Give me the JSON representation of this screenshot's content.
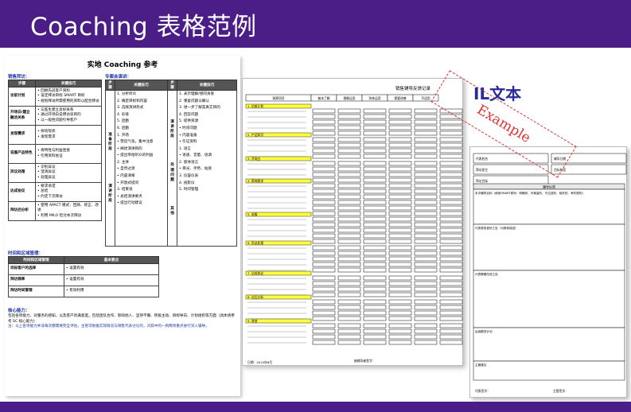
{
  "header": {
    "title": "Coaching 表格范例"
  },
  "doc1": {
    "title": "实地 Coaching 参考",
    "section_sales": "销售拜访：",
    "section_pres": "专案会演讲：",
    "table1_headers": [
      "步骤",
      "关键技巧"
    ],
    "table1_rows": [
      [
        "访前计划",
        "• 回顾先前客户资料\n• 设定拜访目标 SMART 目标\n• 规划拜访所需使用的资料以配合拜访"
      ],
      [
        "开场白/建立融洽关系",
        "• 与医生建立良好关系\n• 通过开场白说明访谈目的\n• 以一般性问题引导客户"
      ],
      [
        "发现需求",
        "• 探询现状\n• 发现需求"
      ],
      [
        "说服产品特色",
        "• 将特性与利益连接\n• 引用资料佐证"
      ],
      [
        "异议处理",
        "• 识别异议\n• 澄清异议\n• 处理异议"
      ],
      [
        "达成协议",
        "• 要求承诺\n• 总结\n• 约定下次拜访"
      ],
      [
        "拜访后分析",
        "• 使用 APACT 模式：回顾、修正、改进\n• 利用 MILO 检讨本次拜访"
      ]
    ],
    "table2_headers": [
      "步骤",
      "关键技巧",
      "步骤",
      "关键技巧"
    ],
    "table2_left_steps": [
      "准备阶段",
      "演讲阶段"
    ],
    "table2_left_items": [
      "1. 分析听众",
      "2. 确定目标和内容",
      "3. 选择演讲形式",
      "4. 彩排",
      "5. 后勤",
      "6. 后勤",
      "1. 开场",
      "• 营造气氛，集中注意",
      "• 阐述演讲目的",
      "• 提出带给听众的利益",
      "2. 主体",
      "• 自然过渡",
      "• 内容清晰",
      "• 开放式提问",
      "3. 结束语",
      "• 总结演讲要点",
      "• 提出行动建议"
    ],
    "table2_right_steps": [
      "演讲阶段",
      "处理问题",
      "其他"
    ],
    "table2_right_items": [
      "1. 表示理解/感同身受",
      "2. 重复问题以确认",
      "3. 进一步了解其真实目的",
      "4. 回答问题",
      "5. 提供资源",
      "• 时间问题",
      "• 内容准备",
      "• 引证资料",
      "1. 语言",
      "• 语速、音量、语调",
      "2. 肢体语言",
      "• 目光、手势、站姿",
      "3. 仪容仪表",
      "4. 投影仪",
      "5. 时间管理"
    ],
    "section_time": "时间和区域管理：",
    "table3_headers": [
      "时间和区域管理",
      "基本要点"
    ],
    "table3_rows": [
      [
        "目标客户的选择",
        "• 设置有效"
      ],
      [
        "拜访频率",
        "• 设置有效"
      ],
      [
        "拜访时间管理",
        "• 有效利用"
      ]
    ],
    "section_core": "核心能力：",
    "core_text": "包括各项能力，对服务的感知，以及客户的满意度。包括团队合作、影响他人、坚持不懈、积极主动、目标导向、计划组织等方面（具体请参考 SC 核心能力）",
    "note_text": "注：以上各项能力并非每次都需要完全评估，主管可根据实际情况与销售代表讨论的，对其中的一到两项重点进行深入辅导。"
  },
  "doc2": {
    "title": "销售辅导反馈记录",
    "col_headers": [
      "观察项目",
      "基本了解",
      "理解运用",
      "熟练运用",
      "需要改善",
      "不适用"
    ],
    "sections": [
      "1. 访前计划",
      "2. 产品知识",
      "3. 开场白",
      "4. 探询需求",
      "5. 说服",
      "6. 异议处理",
      "7. 达成协议",
      "8. 访后分析",
      "9. 其他"
    ],
    "footer": "日期：2010年8月",
    "sign_label": "被辅导者签字："
  },
  "doc3": {
    "title": "辅导反馈",
    "row_labels": [
      "代表姓名",
      "辅导日期",
      "拜访医生",
      "目标科室",
      "拜访目标"
    ],
    "sections": [
      "本次辅导目标（使用SMART原则：明确的、可衡量的、可达成的、相关的、有时限的）",
      "代表表现良好之处（可具体描述）",
      "代表需要改进之处",
      "后续跟进计划",
      "主管建议"
    ],
    "sign_left": "代表签字：",
    "sign_right": "主管签字："
  },
  "stamp": {
    "text": "IL文本",
    "example": "Example"
  }
}
